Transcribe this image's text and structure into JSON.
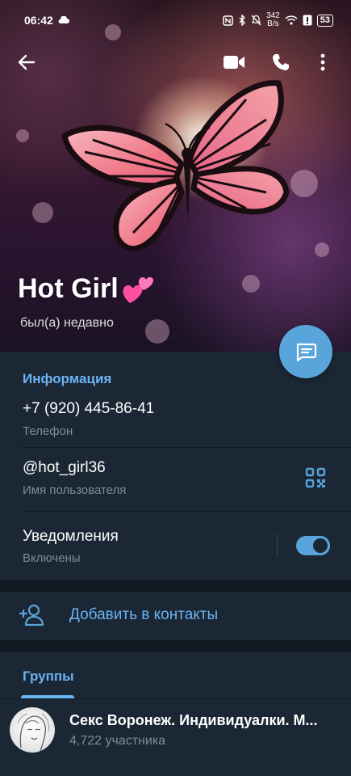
{
  "status_bar": {
    "time": "06:42",
    "net_speed_value": "342",
    "net_speed_unit": "B/s",
    "battery": "53"
  },
  "header": {
    "name": "Hot Girl",
    "last_seen": "был(а) недавно",
    "icons": [
      "back-arrow-icon",
      "video-call-icon",
      "phone-icon",
      "more-vertical-icon"
    ]
  },
  "info": {
    "section_title": "Информация",
    "phone_value": "+7 (920) 445-86-41",
    "phone_label": "Телефон",
    "username_value": "@hot_girl36",
    "username_label": "Имя пользователя",
    "notifications_value": "Уведомления",
    "notifications_label": "Включены",
    "notifications_enabled": true
  },
  "actions": {
    "add_contact": "Добавить в контакты"
  },
  "tabs": {
    "groups": "Группы"
  },
  "groups": [
    {
      "title": "Секс Воронеж. Индивидуалки. М...",
      "subtitle": "4,722 участника"
    }
  ],
  "colors": {
    "accent": "#6ab3f3",
    "fab": "#5aa4dc",
    "background": "#1b2734",
    "separator": "#111a23"
  }
}
